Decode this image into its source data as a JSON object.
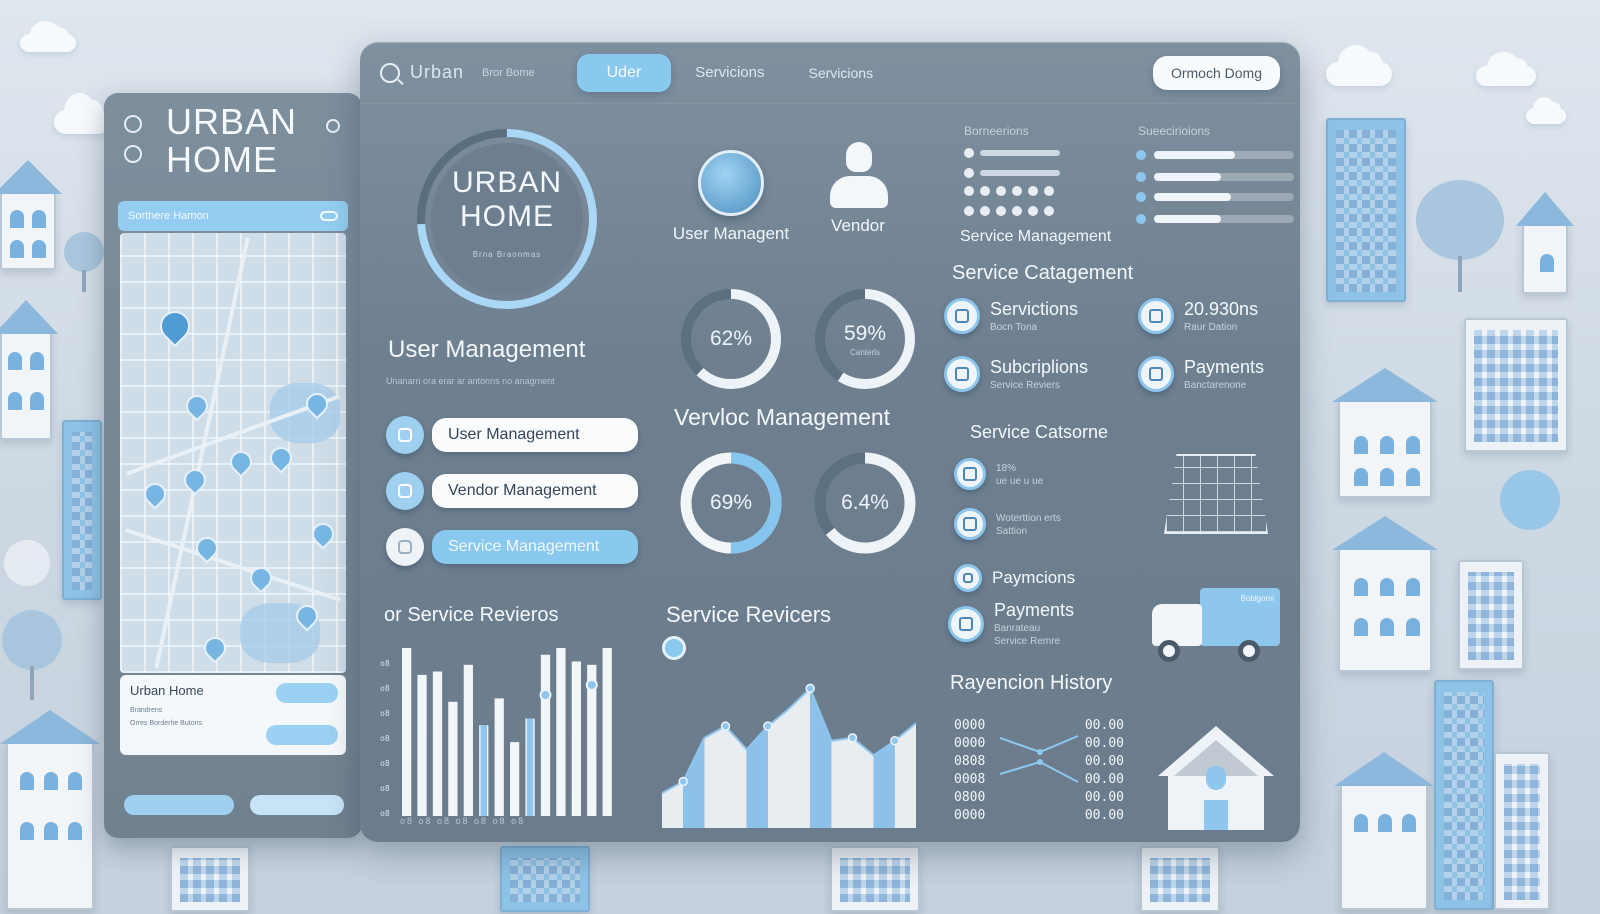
{
  "colors": {
    "accent": "#89c8ef",
    "panel": "#75879 7",
    "white": "#f8fbfd"
  },
  "topbar": {
    "logo_text": "Urban",
    "sub_text": "Bror Bome",
    "tab_active": "Uder",
    "tab_2": "Servicions",
    "tab_3": "Servicions",
    "cta": "Ormoch Domg"
  },
  "sidebar": {
    "title_line1": "URBAN",
    "title_line2": "HOME",
    "search_label": "Sorthere Hamon",
    "card_title": "Urban Home",
    "card_line1": "Brandrens",
    "card_line2": "Orres Borderhe Butons"
  },
  "logo_ring": {
    "line1": "URBAN",
    "line2": "HOME",
    "tagline": "Brna Braonmas"
  },
  "user_section": {
    "title": "User Management",
    "desc": "Unanarn ora erar ar antonns no anagment",
    "nav": [
      {
        "label": "User Management",
        "icon": "hand-icon"
      },
      {
        "label": "Vendor Management",
        "icon": "card-icon"
      },
      {
        "label": "Service Management",
        "icon": "user-icon"
      }
    ]
  },
  "avatars": [
    {
      "label": "User Managent",
      "icon": "user-avatar-icon"
    },
    {
      "label": "Vendor",
      "icon": "vendor-person-icon"
    }
  ],
  "donuts_top": [
    {
      "value": 62,
      "label": "62%",
      "caption": ""
    },
    {
      "value": 59,
      "label": "59%",
      "caption": "Canterls"
    }
  ],
  "vendor_section": {
    "title": "Vervloc Management"
  },
  "donuts_bottom": [
    {
      "value": 50,
      "label": "69%"
    },
    {
      "value": 64,
      "label": "6.4%"
    }
  ],
  "service_reviews_left": {
    "title": "or Service Revieros",
    "axis_labels": "o8  o8  o8  o8  o8  o8  o8"
  },
  "service_reviews_mid": {
    "title": "Service Revicers"
  },
  "chart_data": [
    {
      "type": "bar",
      "categories": [
        "1",
        "2",
        "3",
        "4",
        "5",
        "6",
        "7",
        "8",
        "9",
        "10",
        "11",
        "12",
        "13",
        "14"
      ],
      "series": [
        {
          "values": [
            100,
            84,
            86,
            68,
            90,
            54,
            70,
            44,
            58,
            96,
            100,
            92,
            90,
            100
          ]
        },
        {
          "values": [
            0,
            0,
            0,
            0,
            0,
            54,
            0,
            0,
            58,
            0,
            0,
            0,
            0,
            0
          ]
        }
      ],
      "ylim": [
        0,
        100
      ]
    },
    {
      "type": "area",
      "x": [
        1,
        2,
        3,
        4,
        5,
        6,
        7,
        8,
        9,
        10,
        11,
        12,
        13
      ],
      "series": [
        {
          "values": [
            24,
            32,
            62,
            70,
            54,
            70,
            82,
            96,
            60,
            62,
            50,
            60,
            72
          ]
        }
      ],
      "ylim": [
        0,
        110
      ]
    }
  ],
  "right_col": {
    "small_title_1": "Borneerions",
    "small_title_2": "Sueecirioions",
    "service_mgmt": "Service Management",
    "bars": [
      0.58,
      0.48,
      0.55,
      0.48
    ],
    "service_cat_title": "Service Catagement",
    "feat1_title": "Servictions",
    "feat1_sub": "Bocn Tona",
    "feat2_title": "20.930ns",
    "feat2_sub": "Raur Dation",
    "feat3_title": "Subcriplions",
    "feat3_sub": "Service Reviers",
    "feat4_title": "Payments",
    "feat4_sub": "Banctarenone",
    "service_cats_title": "Service Catsorne",
    "list1_a": "18%",
    "list1_b": "ue ue u ue",
    "list2_a": "Woterttion erts",
    "list2_b": "Sattion",
    "paymcions": "Paymcions",
    "payments2": "Payments",
    "payments2_sub1": "Banrateau",
    "payments2_sub2": "Service Remre",
    "truck_label": "Boblgomi",
    "history_title": "Rayencion History",
    "history_rows": [
      [
        "0000",
        "00.00"
      ],
      [
        "0000",
        "00.00"
      ],
      [
        "0808",
        "00.00"
      ],
      [
        "0008",
        "00.00"
      ],
      [
        "0800",
        "00.00"
      ],
      [
        "0000",
        "00.00"
      ]
    ]
  }
}
